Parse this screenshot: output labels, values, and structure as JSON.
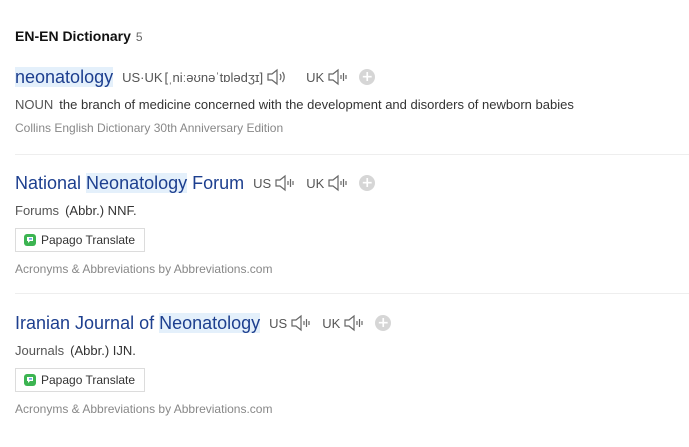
{
  "section": {
    "title": "EN-EN Dictionary",
    "count": "5"
  },
  "entries": [
    {
      "headword_plain_before": "",
      "headword_highlight": "neonatology",
      "headword_plain_after": "",
      "pron": {
        "label1": "US·UK",
        "ipa": "[ˌniːəʊnəˈtɒlədʒɪ]",
        "label2": "UK"
      },
      "pos": "NOUN",
      "definition": "the branch of medicine concerned with the development and disorders of newborn babies",
      "source": "Collins English Dictionary 30th Anniversary Edition"
    },
    {
      "headword_plain_before": "National ",
      "headword_highlight": "Neonatology",
      "headword_plain_after": " Forum",
      "pron": {
        "label1": "US",
        "label2": "UK"
      },
      "pos": "Forums",
      "definition": "(Abbr.) NNF.",
      "translate_label": "Papago Translate",
      "source": "Acronyms & Abbreviations by Abbreviations.com"
    },
    {
      "headword_plain_before": "Iranian Journal of ",
      "headword_highlight": "Neonatology",
      "headword_plain_after": "",
      "pron": {
        "label1": "US",
        "label2": "UK"
      },
      "pos": "Journals",
      "definition": "(Abbr.) IJN.",
      "translate_label": "Papago Translate",
      "source": "Acronyms & Abbreviations by Abbreviations.com"
    }
  ],
  "icons": {
    "speaker": "speaker-icon",
    "add": "plus-circle-icon",
    "papago": "papago-logo-icon"
  },
  "colors": {
    "headword": "#1d3f8f",
    "highlight": "#e4f0fb",
    "papago_green": "#3cb451",
    "papago_blue": "#2f7ee0"
  }
}
